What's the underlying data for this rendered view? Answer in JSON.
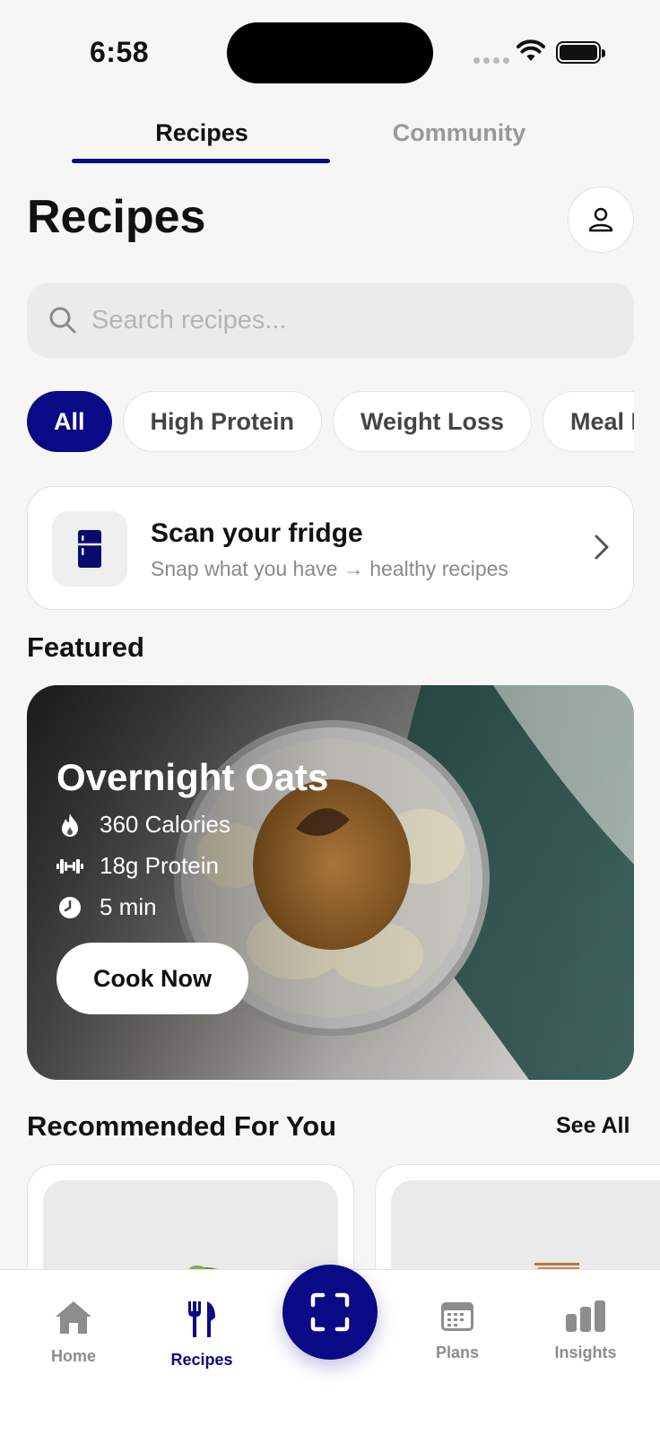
{
  "status_bar": {
    "time": "6:58"
  },
  "top_tabs": [
    {
      "label": "Recipes",
      "active": true
    },
    {
      "label": "Community",
      "active": false
    }
  ],
  "page": {
    "title": "Recipes"
  },
  "search": {
    "placeholder": "Search recipes...",
    "value": ""
  },
  "filter_chips": [
    {
      "label": "All",
      "active": true
    },
    {
      "label": "High Protein",
      "active": false
    },
    {
      "label": "Weight Loss",
      "active": false
    },
    {
      "label": "Meal Prep",
      "active": false
    }
  ],
  "scan_card": {
    "title": "Scan your fridge",
    "subtitle": "Snap what you have → healthy recipes",
    "icon": "fridge-icon"
  },
  "featured": {
    "section_title": "Featured",
    "recipe_title": "Overnight Oats",
    "calories": "360 Calories",
    "protein": "18g Protein",
    "time": "5 min",
    "button_label": "Cook Now"
  },
  "recommended": {
    "section_title": "Recommended For You",
    "see_all_label": "See All"
  },
  "bottom_nav": {
    "items": [
      {
        "label": "Home",
        "icon": "home-icon",
        "active": false
      },
      {
        "label": "Recipes",
        "icon": "fork-knife-icon",
        "active": true
      },
      {
        "label": "Plans",
        "icon": "calendar-icon",
        "active": false
      },
      {
        "label": "Insights",
        "icon": "bar-chart-icon",
        "active": false
      }
    ],
    "center_button_icon": "scan-frame-icon"
  },
  "colors": {
    "accent": "#0a0a86",
    "background": "#f6f6f4",
    "muted_text": "#8a8a8a"
  }
}
